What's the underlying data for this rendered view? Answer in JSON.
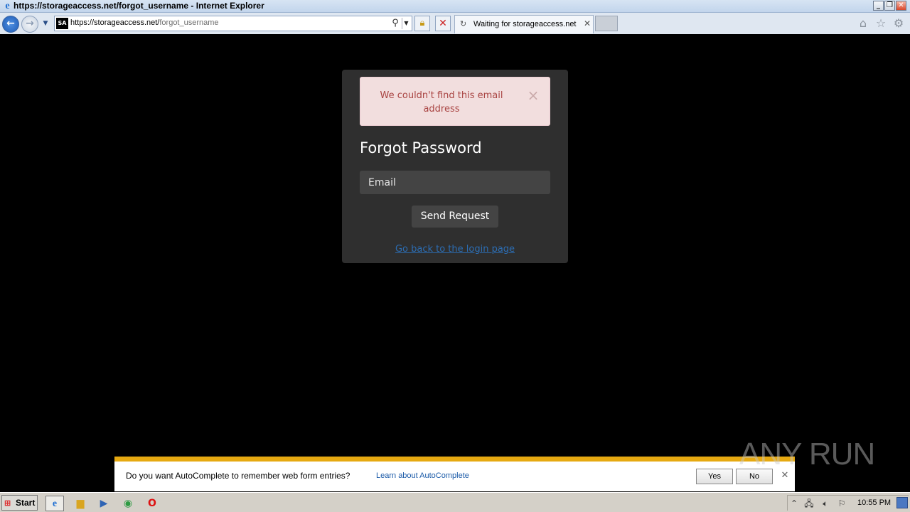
{
  "window": {
    "title": "https://storageaccess.net/forgot_username - Internet Explorer",
    "controls": {
      "minimize": "_",
      "maximize": "❐",
      "close": "✕"
    }
  },
  "navbar": {
    "url_host": "https://storageaccess.net/",
    "url_path": "forgot_username",
    "favicon_text": "SA",
    "tab": {
      "title": "Waiting for storageaccess.net",
      "loading": true
    }
  },
  "page": {
    "alert": {
      "message": "We couldn't find this email address",
      "close": "×",
      "color": "#a94442",
      "background": "#f2dede"
    },
    "title": "Forgot Password",
    "email": {
      "placeholder": "Email",
      "value": ""
    },
    "submit_label": "Send Request",
    "back_link": "Go back to the login page"
  },
  "autocomplete_bar": {
    "question": "Do you want AutoComplete to remember web form entries?",
    "learn_link": "Learn about AutoComplete",
    "yes_label": "Yes",
    "no_label": "No",
    "accent": "#e6a911"
  },
  "watermark": {
    "text": "ANY RUN"
  },
  "taskbar": {
    "start_label": "Start",
    "apps": [
      "internet-explorer",
      "file-explorer",
      "media-player",
      "chrome",
      "opera"
    ],
    "clock": "10:55 PM"
  }
}
